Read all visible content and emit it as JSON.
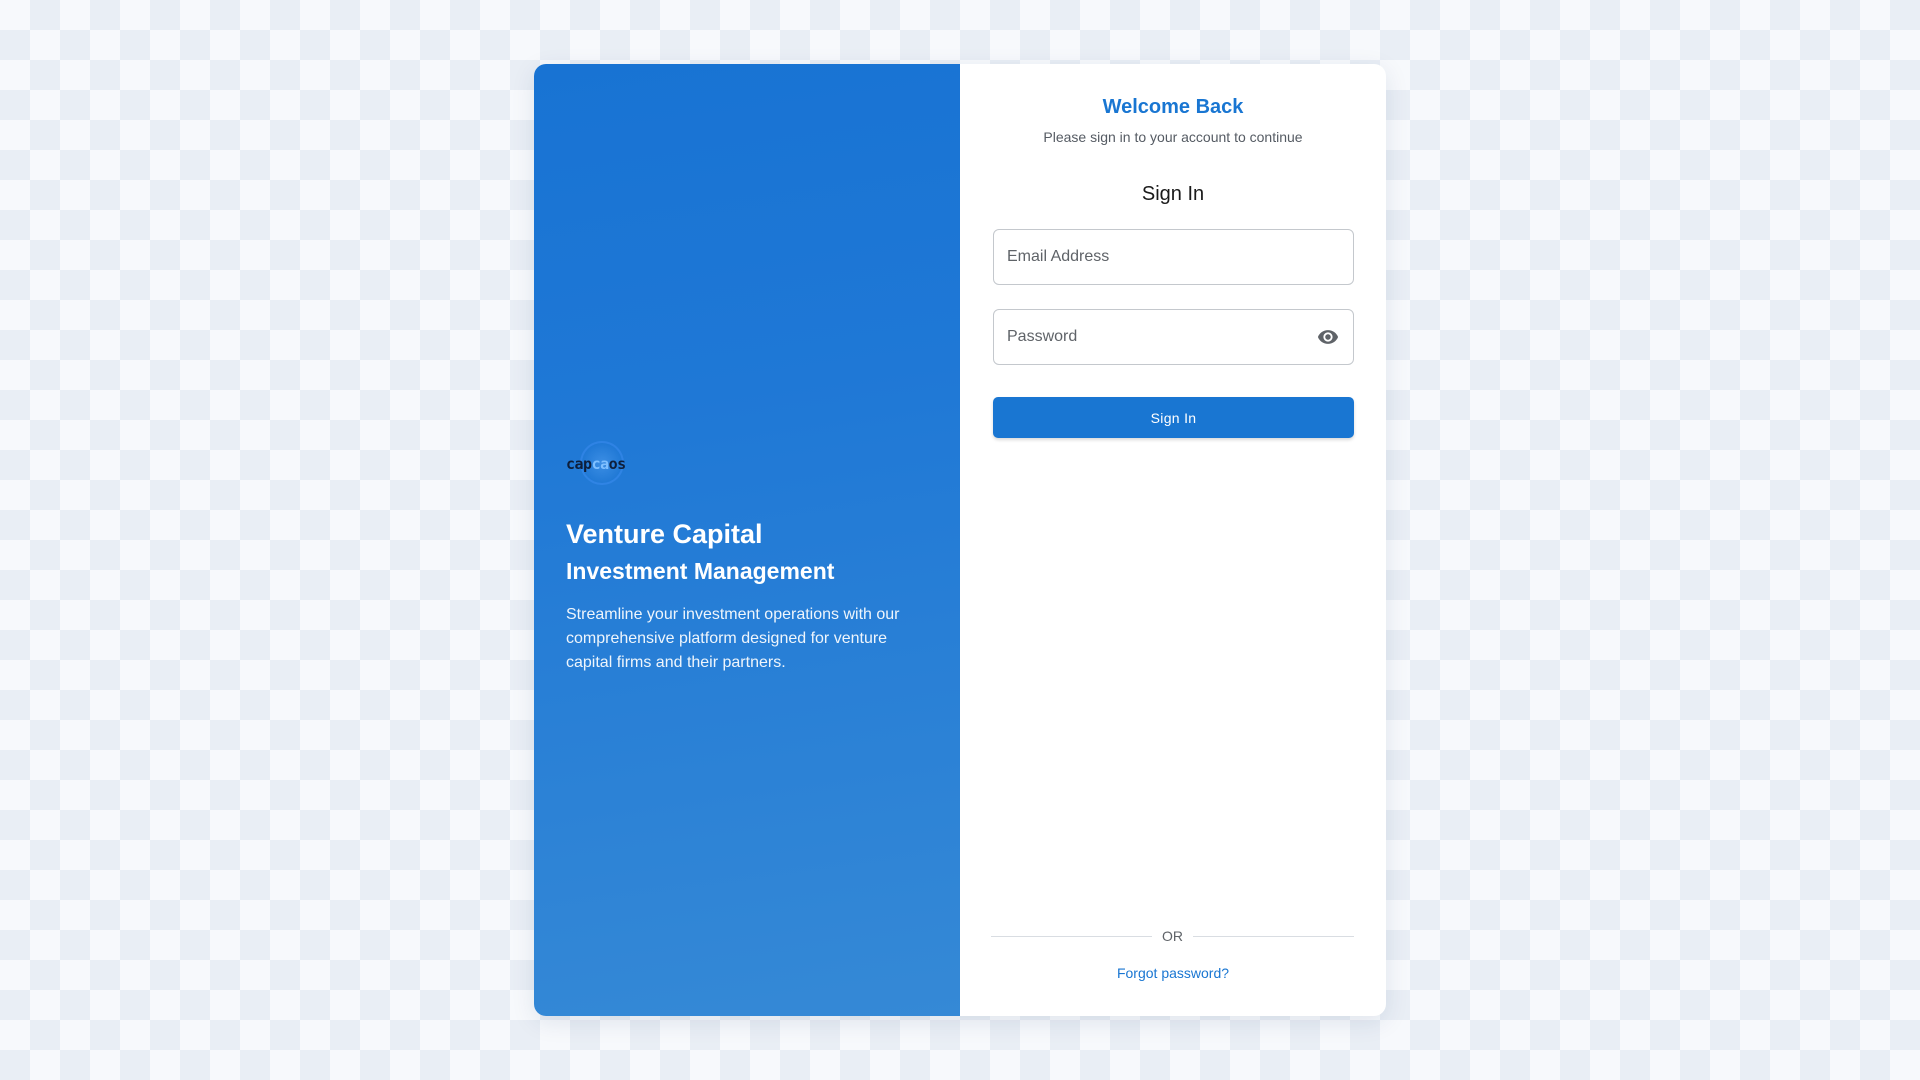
{
  "brand": {
    "logo_left": "cap",
    "logo_mid": "ca",
    "logo_right": "os"
  },
  "hero": {
    "title": "Venture Capital",
    "subtitle": "Investment Management",
    "description": "Streamline your investment operations with our comprehensive platform designed for venture capital firms and their partners."
  },
  "login": {
    "welcome": "Welcome Back",
    "welcome_sub": "Please sign in to your account to continue",
    "form_title": "Sign In",
    "email_placeholder": "Email Address",
    "email_value": "",
    "password_placeholder": "Password",
    "password_value": "",
    "submit_label": "Sign In",
    "divider_label": "OR",
    "forgot_label": "Forgot password?"
  },
  "colors": {
    "accent": "#1976d2",
    "panel_gradient_start": "#1873d3",
    "panel_gradient_end": "#3589d6"
  },
  "icons": {
    "password_toggle": "eye-icon"
  }
}
